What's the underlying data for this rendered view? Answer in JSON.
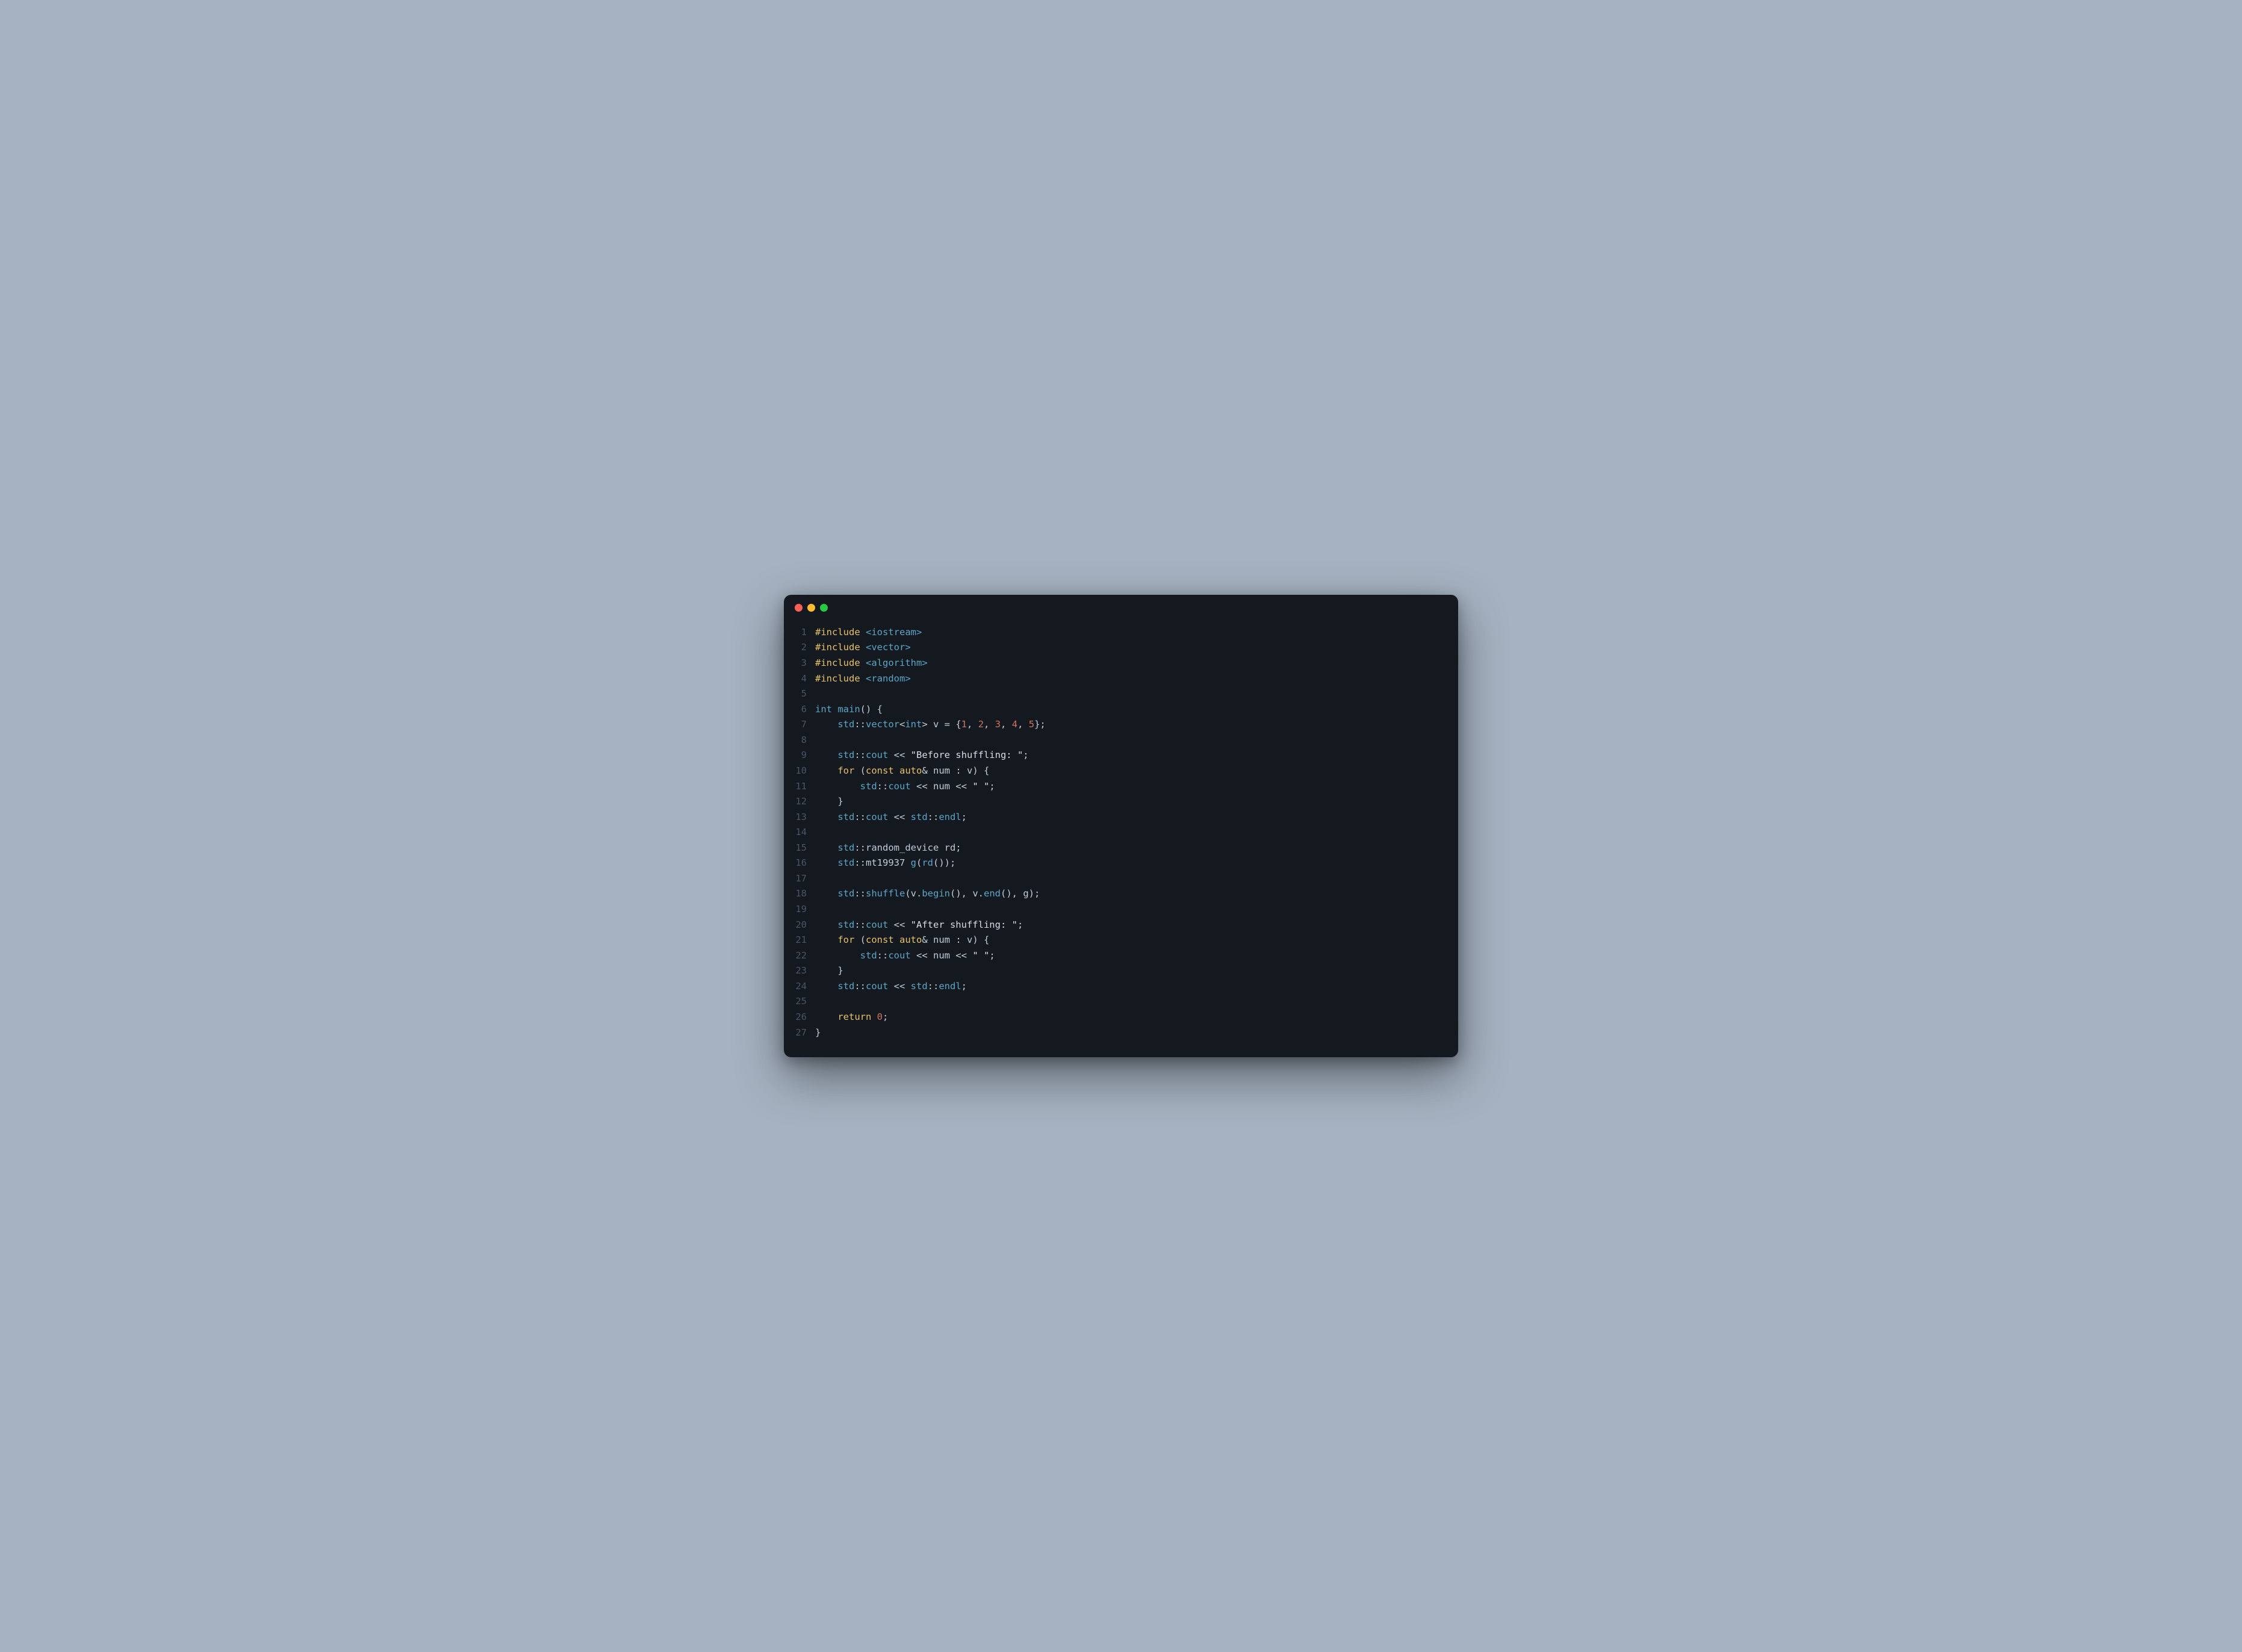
{
  "window": {
    "traffic_lights": [
      "close",
      "minimize",
      "maximize"
    ]
  },
  "colors": {
    "background": "#a5b2c1",
    "editor_bg": "#14181f",
    "close": "#ff5f56",
    "min": "#ffbd2e",
    "max": "#27c93f",
    "keyword": "#e7c26a",
    "builtin": "#5aa7c8",
    "number": "#d17460",
    "text": "#c3ccd9",
    "gutter": "#4b5566"
  },
  "code": {
    "language": "cpp",
    "lines": [
      {
        "n": 1,
        "tokens": [
          [
            "keyword",
            "#include"
          ],
          [
            "punct",
            " "
          ],
          [
            "builtin",
            "<iostream>"
          ]
        ]
      },
      {
        "n": 2,
        "tokens": [
          [
            "keyword",
            "#include"
          ],
          [
            "punct",
            " "
          ],
          [
            "builtin",
            "<vector>"
          ]
        ]
      },
      {
        "n": 3,
        "tokens": [
          [
            "keyword",
            "#include"
          ],
          [
            "punct",
            " "
          ],
          [
            "builtin",
            "<algorithm>"
          ]
        ]
      },
      {
        "n": 4,
        "tokens": [
          [
            "keyword",
            "#include"
          ],
          [
            "punct",
            " "
          ],
          [
            "builtin",
            "<random>"
          ]
        ]
      },
      {
        "n": 5,
        "tokens": []
      },
      {
        "n": 6,
        "tokens": [
          [
            "builtin",
            "int"
          ],
          [
            "punct",
            " "
          ],
          [
            "builtin",
            "main"
          ],
          [
            "punct",
            "() {"
          ]
        ]
      },
      {
        "n": 7,
        "tokens": [
          [
            "punct",
            "    "
          ],
          [
            "builtin",
            "std"
          ],
          [
            "punct",
            "::"
          ],
          [
            "builtin",
            "vector"
          ],
          [
            "punct",
            "<"
          ],
          [
            "builtin",
            "int"
          ],
          [
            "punct",
            "> v = {"
          ],
          [
            "number",
            "1"
          ],
          [
            "punct",
            ", "
          ],
          [
            "number",
            "2"
          ],
          [
            "punct",
            ", "
          ],
          [
            "number",
            "3"
          ],
          [
            "punct",
            ", "
          ],
          [
            "number",
            "4"
          ],
          [
            "punct",
            ", "
          ],
          [
            "number",
            "5"
          ],
          [
            "punct",
            "};"
          ]
        ]
      },
      {
        "n": 8,
        "tokens": []
      },
      {
        "n": 9,
        "tokens": [
          [
            "punct",
            "    "
          ],
          [
            "builtin",
            "std"
          ],
          [
            "punct",
            "::"
          ],
          [
            "builtin",
            "cout"
          ],
          [
            "punct",
            " << "
          ],
          [
            "string",
            "\"Before shuffling: \""
          ],
          [
            "punct",
            ";"
          ]
        ]
      },
      {
        "n": 10,
        "tokens": [
          [
            "punct",
            "    "
          ],
          [
            "keyword",
            "for"
          ],
          [
            "punct",
            " ("
          ],
          [
            "keyword",
            "const"
          ],
          [
            "punct",
            " "
          ],
          [
            "keyword",
            "auto"
          ],
          [
            "punct",
            "& num : v) {"
          ]
        ]
      },
      {
        "n": 11,
        "tokens": [
          [
            "punct",
            "        "
          ],
          [
            "builtin",
            "std"
          ],
          [
            "punct",
            "::"
          ],
          [
            "builtin",
            "cout"
          ],
          [
            "punct",
            " << num << "
          ],
          [
            "string",
            "\" \""
          ],
          [
            "punct",
            ";"
          ]
        ]
      },
      {
        "n": 12,
        "tokens": [
          [
            "punct",
            "    }"
          ]
        ]
      },
      {
        "n": 13,
        "tokens": [
          [
            "punct",
            "    "
          ],
          [
            "builtin",
            "std"
          ],
          [
            "punct",
            "::"
          ],
          [
            "builtin",
            "cout"
          ],
          [
            "punct",
            " << "
          ],
          [
            "builtin",
            "std"
          ],
          [
            "punct",
            "::"
          ],
          [
            "builtin",
            "endl"
          ],
          [
            "punct",
            ";"
          ]
        ]
      },
      {
        "n": 14,
        "tokens": []
      },
      {
        "n": 15,
        "tokens": [
          [
            "punct",
            "    "
          ],
          [
            "builtin",
            "std"
          ],
          [
            "punct",
            "::random_device rd;"
          ]
        ]
      },
      {
        "n": 16,
        "tokens": [
          [
            "punct",
            "    "
          ],
          [
            "builtin",
            "std"
          ],
          [
            "punct",
            "::mt19937 "
          ],
          [
            "builtin",
            "g"
          ],
          [
            "punct",
            "("
          ],
          [
            "builtin",
            "rd"
          ],
          [
            "punct",
            "());"
          ]
        ]
      },
      {
        "n": 17,
        "tokens": []
      },
      {
        "n": 18,
        "tokens": [
          [
            "punct",
            "    "
          ],
          [
            "builtin",
            "std"
          ],
          [
            "punct",
            "::"
          ],
          [
            "builtin",
            "shuffle"
          ],
          [
            "punct",
            "(v."
          ],
          [
            "builtin",
            "begin"
          ],
          [
            "punct",
            "(), v."
          ],
          [
            "builtin",
            "end"
          ],
          [
            "punct",
            "(), g);"
          ]
        ]
      },
      {
        "n": 19,
        "tokens": []
      },
      {
        "n": 20,
        "tokens": [
          [
            "punct",
            "    "
          ],
          [
            "builtin",
            "std"
          ],
          [
            "punct",
            "::"
          ],
          [
            "builtin",
            "cout"
          ],
          [
            "punct",
            " << "
          ],
          [
            "string",
            "\"After shuffling: \""
          ],
          [
            "punct",
            ";"
          ]
        ]
      },
      {
        "n": 21,
        "tokens": [
          [
            "punct",
            "    "
          ],
          [
            "keyword",
            "for"
          ],
          [
            "punct",
            " ("
          ],
          [
            "keyword",
            "const"
          ],
          [
            "punct",
            " "
          ],
          [
            "keyword",
            "auto"
          ],
          [
            "punct",
            "& num : v) {"
          ]
        ]
      },
      {
        "n": 22,
        "tokens": [
          [
            "punct",
            "        "
          ],
          [
            "builtin",
            "std"
          ],
          [
            "punct",
            "::"
          ],
          [
            "builtin",
            "cout"
          ],
          [
            "punct",
            " << num << "
          ],
          [
            "string",
            "\" \""
          ],
          [
            "punct",
            ";"
          ]
        ]
      },
      {
        "n": 23,
        "tokens": [
          [
            "punct",
            "    }"
          ]
        ]
      },
      {
        "n": 24,
        "tokens": [
          [
            "punct",
            "    "
          ],
          [
            "builtin",
            "std"
          ],
          [
            "punct",
            "::"
          ],
          [
            "builtin",
            "cout"
          ],
          [
            "punct",
            " << "
          ],
          [
            "builtin",
            "std"
          ],
          [
            "punct",
            "::"
          ],
          [
            "builtin",
            "endl"
          ],
          [
            "punct",
            ";"
          ]
        ]
      },
      {
        "n": 25,
        "tokens": []
      },
      {
        "n": 26,
        "tokens": [
          [
            "punct",
            "    "
          ],
          [
            "keyword",
            "return"
          ],
          [
            "punct",
            " "
          ],
          [
            "number",
            "0"
          ],
          [
            "punct",
            ";"
          ]
        ]
      },
      {
        "n": 27,
        "tokens": [
          [
            "punct",
            "}"
          ]
        ]
      }
    ]
  },
  "watermark": ""
}
